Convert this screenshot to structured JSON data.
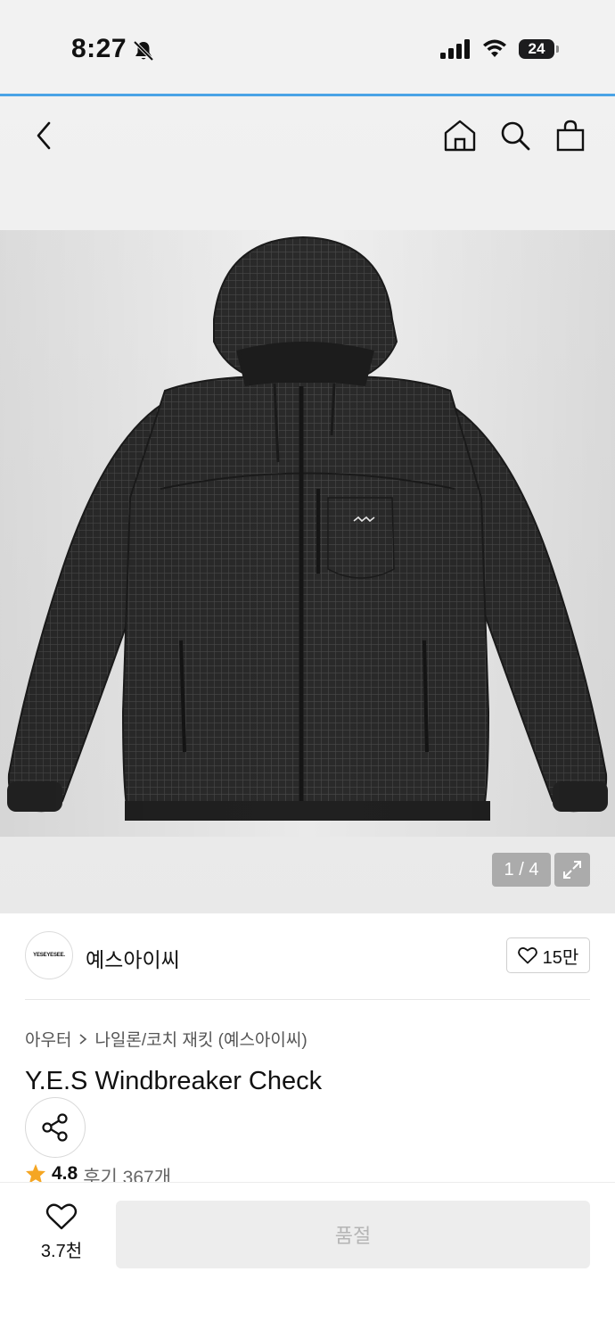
{
  "status_bar": {
    "time": "8:27",
    "battery": "24"
  },
  "gallery": {
    "counter": "1 / 4"
  },
  "brand": {
    "logo_text": "YESEYESEE.",
    "name": "예스아이씨",
    "like_count": "15만"
  },
  "breadcrumb": {
    "category": "아우터",
    "subcategory": "나일론/코치 재킷 (예스아이씨)"
  },
  "product": {
    "title": "Y.E.S Windbreaker Check",
    "rating": "4.8",
    "reviews": "후기 367개"
  },
  "bottom_bar": {
    "wish_count": "3.7천",
    "purchase_label": "품절"
  },
  "colors": {
    "accent_line": "#4aa3e6",
    "star": "#f5a623",
    "disabled_button": "#ededed"
  }
}
